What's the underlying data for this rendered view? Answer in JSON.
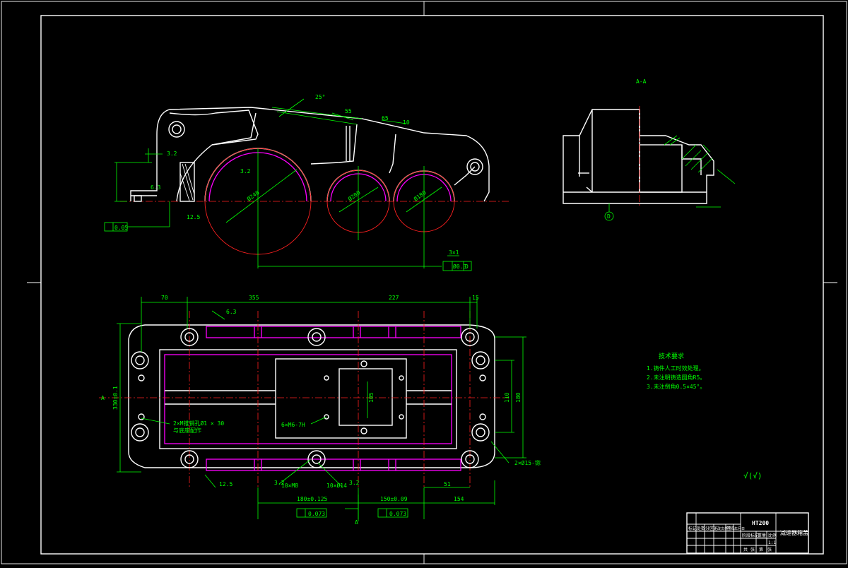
{
  "section_label": "A-A",
  "datum_letter": "D",
  "datum_letter_top": "A",
  "datum_letter_bottom": "A",
  "front_view": {
    "top_angle_dim": "25°",
    "dims": [
      "55",
      "65",
      "10"
    ],
    "roughness": [
      "3.2",
      "6.3",
      "12.5",
      "3.2"
    ],
    "bore_dims": [
      "Ø240",
      "Ø200",
      "Ø180"
    ],
    "flatness_tol": "0.05",
    "position_tol_label": "Ø0.3",
    "position_tol_datum": "D",
    "label_31": "3×1"
  },
  "plan_view": {
    "top_dims": [
      "70",
      "355",
      "227",
      "15"
    ],
    "left_height": "330±0.1",
    "right_dims": [
      "110",
      "180"
    ],
    "bottom_dims": [
      "180±0.125",
      "150±0.09",
      "154"
    ],
    "parallel_tols": [
      "0.073",
      "0.073"
    ],
    "note_left": "2×M锥销孔Ø1 × 30\n与底座配作",
    "note_center": "6×M6-7H",
    "note_right": "2×Ø15-锪",
    "label_dim_13": "105",
    "label_dim_51": "51",
    "bottom_callouts": [
      "10×M8",
      "10×Ø14"
    ],
    "roughness": [
      "6.3",
      "12.5",
      "3.2",
      "3.2"
    ]
  },
  "tech_requirements": {
    "title": "技术要求",
    "items": [
      "1.铸件人工时效处理。",
      "2.未注明铸造圆角R5。",
      "3.未注倒角0.5×45°。"
    ]
  },
  "roughness_symbol": "√(√)",
  "title_block": {
    "drawing_no": "HT200",
    "part_name": "减速器箱盖",
    "row_labels": [
      "标记",
      "处数",
      "分区",
      "更改文件号",
      "签名",
      "年月日"
    ],
    "stage_labels": [
      "阶段标记",
      "重量",
      "比例"
    ],
    "bottom_labels": [
      "共",
      "张",
      "第",
      "张"
    ],
    "ratio": "1:1"
  }
}
